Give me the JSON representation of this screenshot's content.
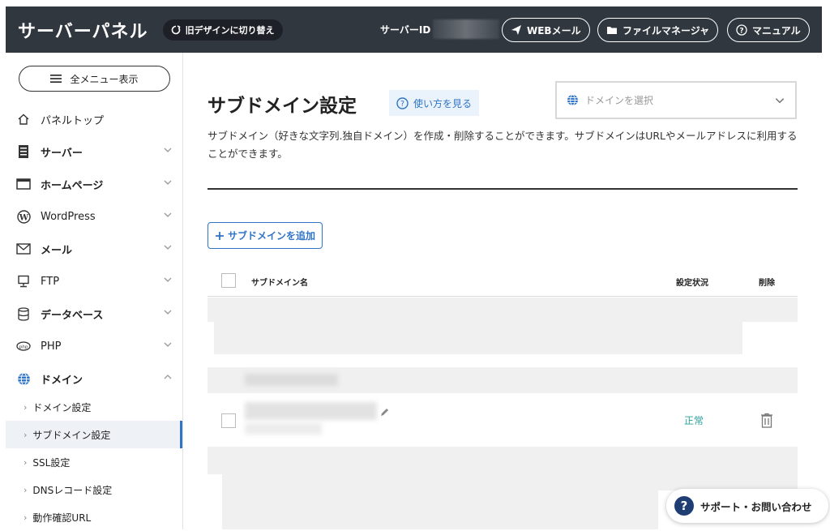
{
  "header": {
    "brand": "サーバーパネル",
    "old_design_label": "旧デザインに切り替え",
    "server_id_label": "サーバーID",
    "webmail_label": "WEBメール",
    "file_manager_label": "ファイルマネージャ",
    "manual_label": "マニュアル"
  },
  "sidebar": {
    "all_menu_label": "全メニュー表示",
    "items": [
      {
        "label": "パネルトップ",
        "icon": "home-icon"
      },
      {
        "label": "サーバー",
        "icon": "server-icon"
      },
      {
        "label": "ホームページ",
        "icon": "browser-icon"
      },
      {
        "label": "WordPress",
        "icon": "wordpress-icon"
      },
      {
        "label": "メール",
        "icon": "mail-icon"
      },
      {
        "label": "FTP",
        "icon": "ftp-icon"
      },
      {
        "label": "データベース",
        "icon": "database-icon"
      },
      {
        "label": "PHP",
        "icon": "php-icon"
      },
      {
        "label": "ドメイン",
        "icon": "globe-icon"
      }
    ],
    "sub_items": [
      {
        "label": "ドメイン設定"
      },
      {
        "label": "サブドメイン設定"
      },
      {
        "label": "SSL設定"
      },
      {
        "label": "DNSレコード設定"
      },
      {
        "label": "動作確認URL"
      }
    ]
  },
  "main": {
    "title": "サブドメイン設定",
    "howto_label": "使い方を見る",
    "domain_select_placeholder": "ドメインを選択",
    "description": "サブドメイン（好きな文字列.独自ドメイン）を作成・削除することができます。サブドメインはURLやメールアドレスに利用することができます。",
    "add_button_label": "サブドメインを追加",
    "table": {
      "col_name": "サブドメイン名",
      "col_status": "設定状況",
      "col_delete": "削除"
    },
    "row_status": "正常"
  },
  "support_label": "サポート・お問い合わせ",
  "colors": {
    "accent": "#2f74c7",
    "header_bg": "#31373f",
    "status_ok": "#2aa39a"
  }
}
